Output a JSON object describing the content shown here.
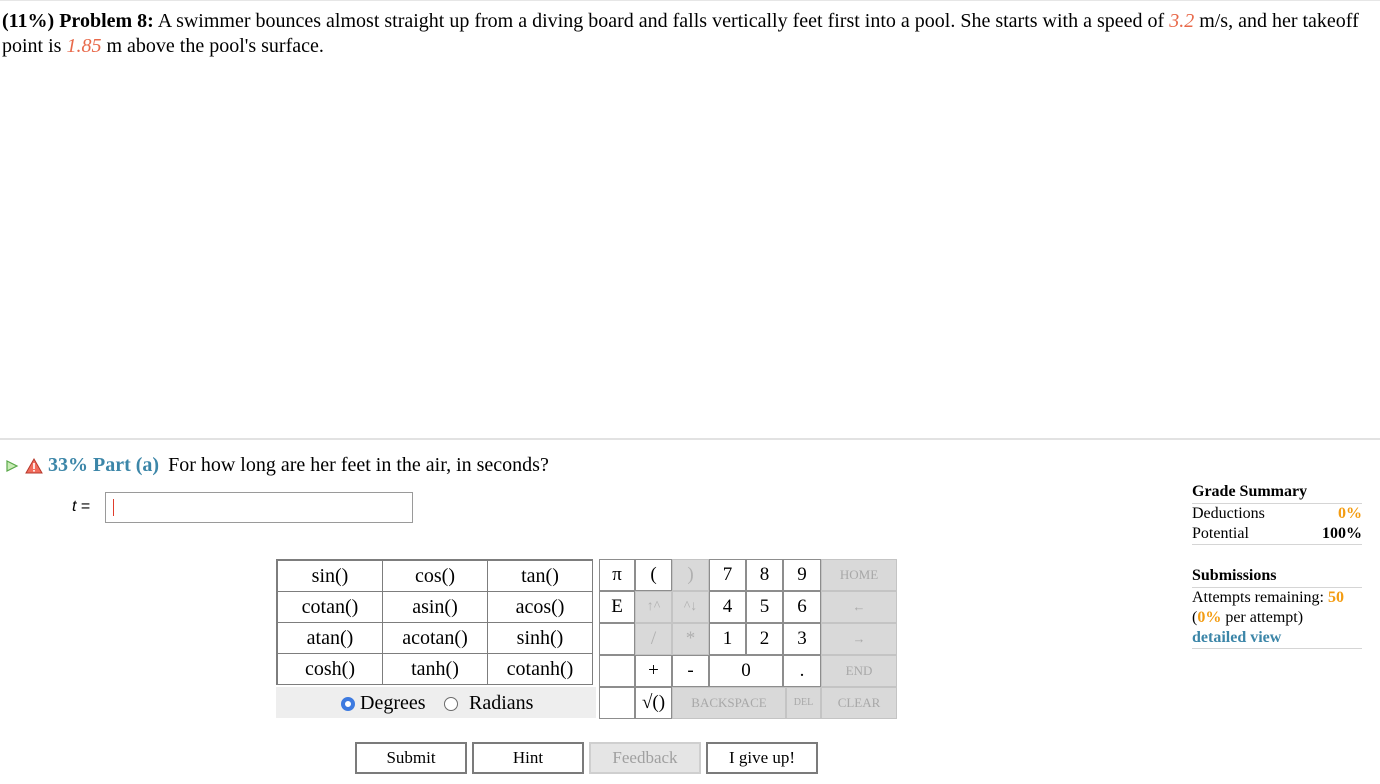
{
  "problem": {
    "weight": "(11%)",
    "title": "Problem 8:",
    "text_1": "A swimmer bounces almost straight up from a diving board and falls vertically feet first into a pool. She starts with a speed of ",
    "speed": "3.2",
    "text_2": " m/s, and her takeoff point is ",
    "height": "1.85",
    "text_3": " m above the pool's surface."
  },
  "part": {
    "percent": "33%",
    "label": "Part (a)",
    "question": "For how long are her feet in the air, in seconds?",
    "var": "t",
    "equals": " = ",
    "value": ""
  },
  "functions": [
    [
      "sin()",
      "cos()",
      "tan()"
    ],
    [
      "cotan()",
      "asin()",
      "acos()"
    ],
    [
      "atan()",
      "acotan()",
      "sinh()"
    ],
    [
      "cosh()",
      "tanh()",
      "cotanh()"
    ]
  ],
  "angle": {
    "degrees": "Degrees",
    "radians": "Radians",
    "selected": "Degrees"
  },
  "keypad": {
    "pi": "π",
    "e": "E",
    "open": "(",
    "close": ")",
    "up": "↑^",
    "down": "^↓",
    "divide": "/",
    "times": "*",
    "plus": "+",
    "minus": "-",
    "sqrt": "√()",
    "d7": "7",
    "d8": "8",
    "d9": "9",
    "d4": "4",
    "d5": "5",
    "d6": "6",
    "d1": "1",
    "d2": "2",
    "d3": "3",
    "d0": "0",
    "dot": ".",
    "home": "HOME",
    "left": "←",
    "right": "→",
    "end": "END",
    "backspace": "BACKSPACE",
    "del": "DEL",
    "clear": "CLEAR"
  },
  "buttons": {
    "submit": "Submit",
    "hint": "Hint",
    "feedback": "Feedback",
    "giveup": "I give up!"
  },
  "grade": {
    "title": "Grade Summary",
    "deductions_label": "Deductions",
    "deductions": "0%",
    "potential_label": "Potential",
    "potential": "100%",
    "submissions_title": "Submissions",
    "attempts_label": "Attempts remaining: ",
    "attempts": "50",
    "per_open": "(",
    "per_pct": "0%",
    "per_close": " per attempt)",
    "detailed": "detailed view"
  },
  "colors": {
    "accent": "#3c86a8",
    "value": "#e8694a",
    "orange": "#f39c12",
    "radio": "#3d7ae0"
  }
}
